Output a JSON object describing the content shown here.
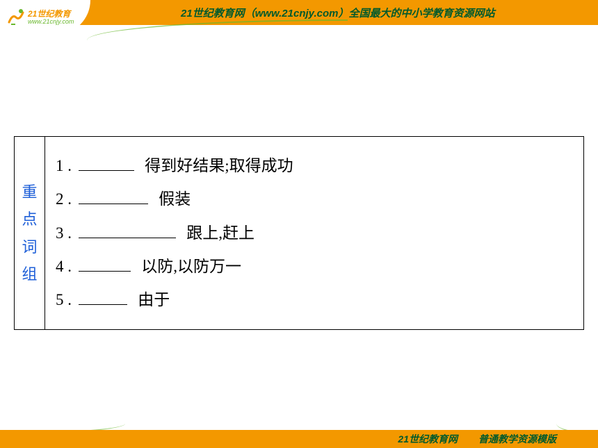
{
  "header": {
    "logo_cn": "21世纪教育",
    "logo_url": "www.21cnjy.com",
    "brand_text": "21世纪教育网",
    "brand_url": "（www.21cnjy.com）",
    "tagline": "全国最大的中小学教育资源网站"
  },
  "table": {
    "heading_chars": [
      "重",
      "点",
      "词",
      "组"
    ],
    "items": [
      {
        "num": "1 .",
        "definition": "得到好结果;取得成功"
      },
      {
        "num": "2 .",
        "definition": "假装"
      },
      {
        "num": "3 .",
        "definition": "跟上,赶上"
      },
      {
        "num": "4 .",
        "definition": "以防,以防万一"
      },
      {
        "num": "5 .",
        "definition": "由于"
      }
    ]
  },
  "footer": {
    "brand": "21世纪教育网",
    "template": "普通教学资源模版"
  }
}
